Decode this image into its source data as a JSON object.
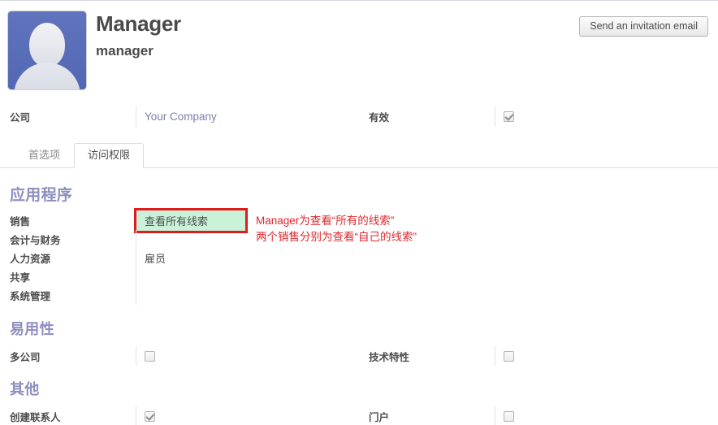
{
  "header": {
    "record_title": "Manager",
    "record_subtitle": "manager",
    "invite_button": "Send an invitation email",
    "avatar_name": "default-user-avatar",
    "avatar_color": "#5268b4"
  },
  "header_fields": {
    "company_label": "公司",
    "company_value": "Your Company",
    "active_label": "有效",
    "active_checked": true
  },
  "tabs": [
    {
      "label": "首选项",
      "active": false
    },
    {
      "label": "访问权限",
      "active": true
    }
  ],
  "groups": [
    {
      "title": "应用程序",
      "rows": [
        {
          "label": "销售",
          "value": "查看所有线索",
          "highlighted": true
        },
        {
          "label": "会计与财务",
          "value": "",
          "highlighted": false
        },
        {
          "label": "人力资源",
          "value": "雇员",
          "highlighted": false
        },
        {
          "label": "共享",
          "value": "",
          "highlighted": false
        },
        {
          "label": "系统管理",
          "value": "",
          "highlighted": false
        }
      ]
    },
    {
      "title": "易用性",
      "checkbox_rows": [
        {
          "left_label": "多公司",
          "left_checked": false,
          "right_label": "技术特性",
          "right_checked": false
        }
      ]
    },
    {
      "title": "其他",
      "checkbox_rows": [
        {
          "left_label": "创建联系人",
          "left_checked": true,
          "right_label": "门户",
          "right_checked": false
        }
      ]
    }
  ],
  "annotation": {
    "line1": "Manager为查看“所有的线索”",
    "line2": "两个销售分别为查看“自己的线索”",
    "color": "#e0262c"
  }
}
